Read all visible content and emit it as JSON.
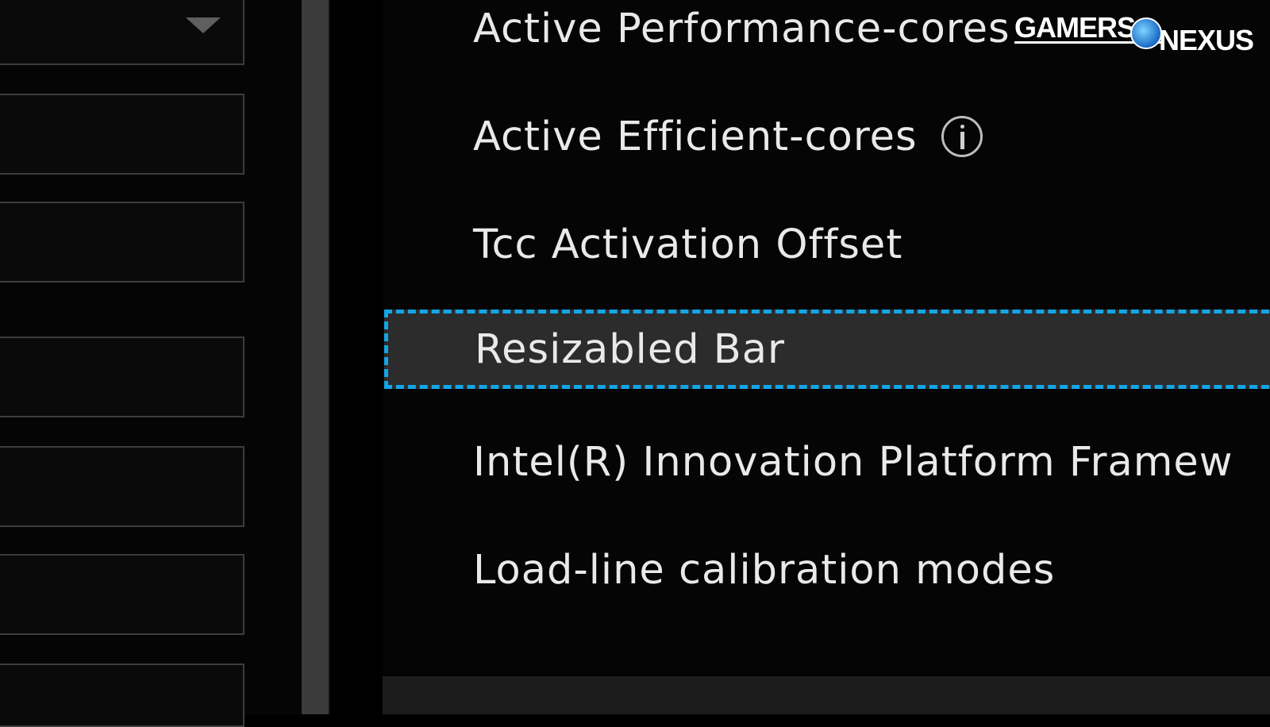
{
  "settings_list": {
    "items": [
      {
        "label": "Active Performance-cores"
      },
      {
        "label": "Active Efficient-cores"
      },
      {
        "label": "Tcc Activation Offset"
      },
      {
        "label": "Resizabled Bar",
        "selected": true
      },
      {
        "label": "Intel(R) Innovation Platform Framew"
      },
      {
        "label": "Load-line calibration modes"
      }
    ]
  },
  "left_panel": {
    "fields": [
      {
        "type": "dropdown",
        "value": ""
      },
      {
        "type": "input",
        "value": ""
      },
      {
        "type": "input",
        "value": ""
      },
      {
        "type": "input",
        "value": ""
      },
      {
        "type": "input",
        "value": ""
      },
      {
        "type": "input",
        "value": ""
      },
      {
        "type": "input",
        "value": ""
      }
    ]
  },
  "watermark": {
    "text_part1": "GAMERS",
    "text_part2": "NEXUS"
  },
  "icons": {
    "info": "info-icon",
    "dropdown": "chevron-down-icon"
  },
  "colors": {
    "selection_border": "#14a5e6",
    "selected_bg": "#2c2c2c",
    "text": "#e9e9e9"
  }
}
